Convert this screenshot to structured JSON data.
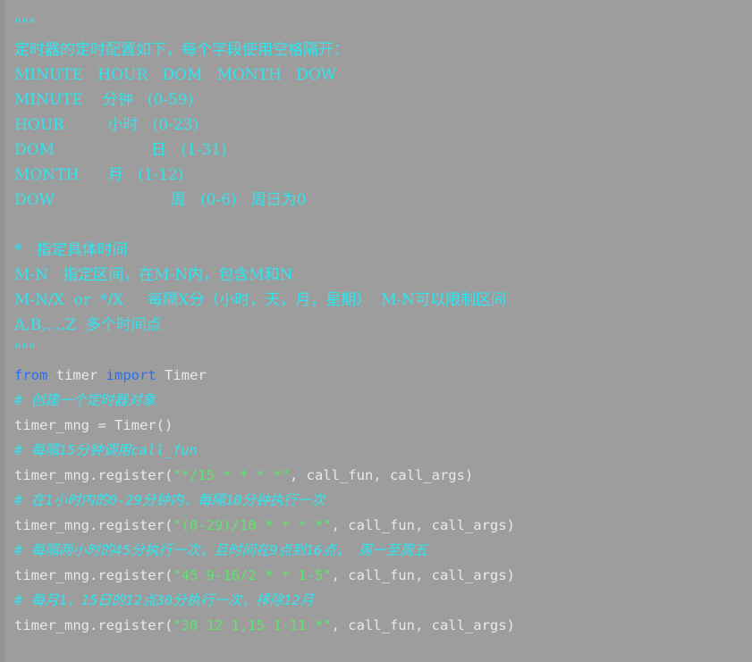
{
  "editor": {
    "background_color": "#9d9d9d",
    "gutter_color": "#949494",
    "language": "Python",
    "colors": {
      "docstring": "#2ee6f0",
      "comment": "#2ee6f0",
      "string": "#5ce66b",
      "keyword": "#2b6ff5",
      "identifier": "#e9e9e9"
    }
  },
  "code": {
    "docstring_open": "\"\"\"",
    "docstring_close": "\"\"\"",
    "doc_lines": [
      "定时器的定时配置如下，每个字段使用空格隔开：",
      "MINUTE   HOUR   DOM   MONTH   DOW",
      "MINUTE    分钟   (0-59)",
      "HOUR         小时   (0-23)",
      "DOM                    日   (1-31)",
      "MONTH      月   (1-12)",
      "DOW                        周   (0-6)   周日为0",
      "*   指定具体时间",
      "M-N   指定区间，在M-N内，包含M和N",
      "M-N/X  or  */X     每隔X分（小时，天，月，星期）  M-N可以限制区间",
      "A,B,...,Z  多个时间点"
    ],
    "import_line": {
      "keyword_from": "from",
      "module": " timer ",
      "keyword_import": "import",
      "name": " Timer"
    },
    "statements": [
      {
        "comment": "# 创建一个定时器对象",
        "code_prefix": "timer_mng = Timer()",
        "string": "",
        "code_suffix": ""
      },
      {
        "comment": "# 每隔15分钟调用call_fun",
        "code_prefix": "timer_mng.register(",
        "string": "\"*/15 * * * *\"",
        "code_suffix": ", call_fun, call_args)"
      },
      {
        "comment": "# 在1小时内的0-29分钟内，每隔10分钟执行一次",
        "code_prefix": "timer_mng.register(",
        "string": "\"(0-29)/10 * * * *\"",
        "code_suffix": ", call_fun, call_args)"
      },
      {
        "comment": "# 每隔两小时的45分执行一次，且时间在9点到16点， 周一至周五",
        "code_prefix": "timer_mng.register(",
        "string": "\"45 9-16/2 * * 1-5\"",
        "code_suffix": ", call_fun, call_args)"
      },
      {
        "comment": "# 每月1，15日的12点30分执行一次，排除12月",
        "code_prefix": "timer_mng.register(",
        "string": "\"30 12 1,15 1-11 *\"",
        "code_suffix": ", call_fun, call_args)"
      }
    ]
  }
}
